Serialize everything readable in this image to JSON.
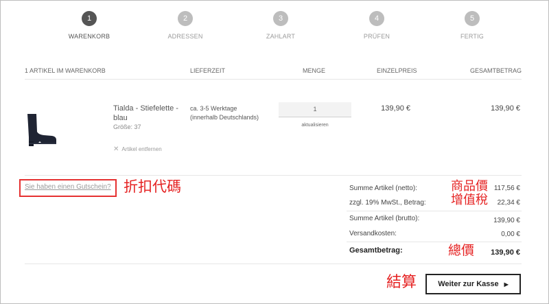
{
  "steps": [
    {
      "number": "1",
      "label": "WARENKORB",
      "active": true
    },
    {
      "number": "2",
      "label": "ADRESSEN",
      "active": false
    },
    {
      "number": "3",
      "label": "ZAHLART",
      "active": false
    },
    {
      "number": "4",
      "label": "PRÜFEN",
      "active": false
    },
    {
      "number": "5",
      "label": "FERTIG",
      "active": false
    }
  ],
  "table": {
    "headers": {
      "items": "1 ARTIKEL IM WARENKORB",
      "delivery": "LIEFERZEIT",
      "quantity": "MENGE",
      "unit_price": "EINZELPREIS",
      "total": "GESAMTBETRAG"
    },
    "item": {
      "name_line1": "Tialda - Stiefelette -",
      "name_line2": "blau",
      "size": "Größe: 37",
      "remove": "Artikel entfernen",
      "delivery_line1": "ca. 3-5 Werktage",
      "delivery_line2": "(innerhalb Deutschlands)",
      "quantity": "1",
      "update": "aktualisieren",
      "unit_price": "139,90 €",
      "total": "139,90 €"
    }
  },
  "coupon": {
    "link": "Sie haben einen Gutschein?",
    "annotation": "折扣代碼"
  },
  "summary": {
    "net_label": "Summe Artikel (netto):",
    "net_value": "117,56 €",
    "vat_label": "zzgl. 19% MwSt., Betrag:",
    "vat_value": "22,34 €",
    "gross_label": "Summe Artikel (brutto):",
    "gross_value": "139,90 €",
    "shipping_label": "Versandkosten:",
    "shipping_value": "0,00 €",
    "total_label": "Gesamtbetrag:",
    "total_value": "139,90 €"
  },
  "annotations": {
    "net": "商品價",
    "vat": "增值稅",
    "total": "總價",
    "checkout": "結算"
  },
  "checkout_button": "Weiter zur Kasse",
  "colors": {
    "active_step": "#555555",
    "inactive_step": "#bdbdbd",
    "annotation_red": "#e52222"
  }
}
